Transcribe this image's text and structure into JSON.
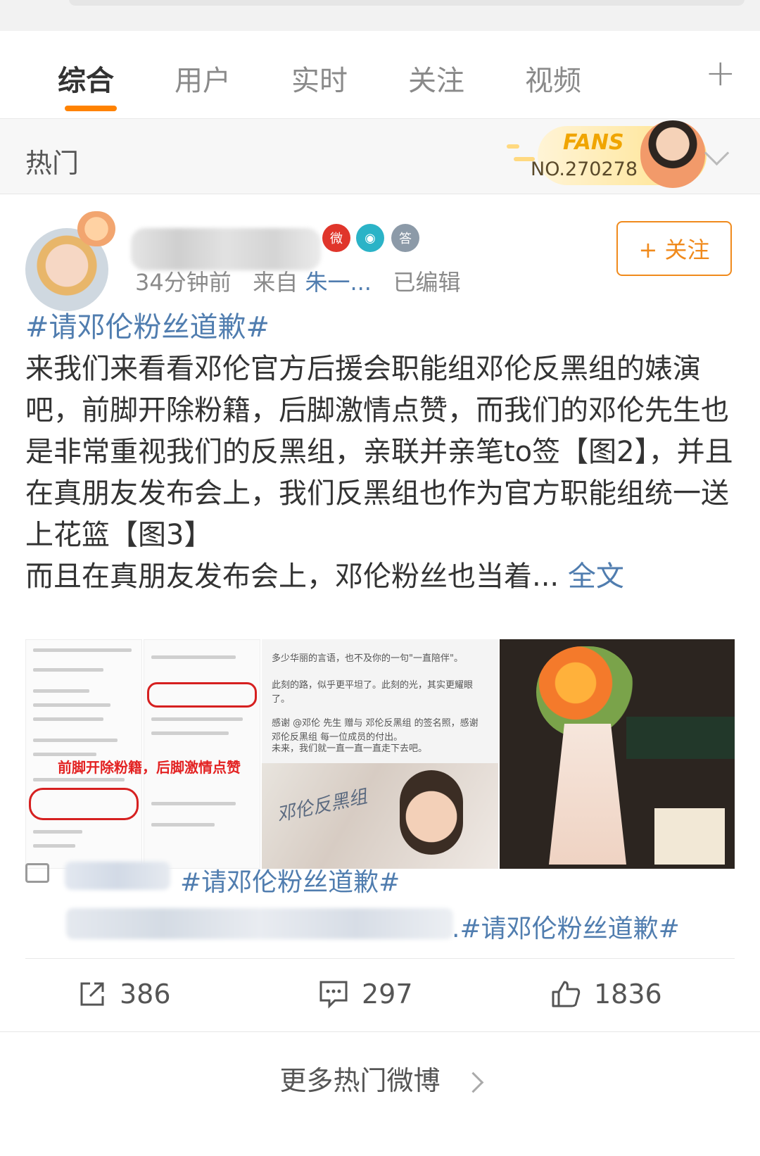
{
  "tabs": {
    "items": [
      {
        "label": "综合",
        "active": true
      },
      {
        "label": "用户"
      },
      {
        "label": "实时"
      },
      {
        "label": "关注"
      },
      {
        "label": "视频"
      }
    ],
    "more_icon": "plus-icon"
  },
  "hot": {
    "label": "热门",
    "fans_badge": {
      "title": "FANS",
      "number": "NO.270278"
    },
    "expand_icon": "chevron-down-icon"
  },
  "post": {
    "meta": {
      "time": "34分钟前",
      "from_prefix": "来自",
      "source": "朱一...",
      "edited": "已编辑"
    },
    "badges": [
      "weibo-icon",
      "camera-icon",
      "answer-icon"
    ],
    "follow_label": "+ 关注",
    "hashtag": "#请邓伦粉丝道歉#",
    "body": "来我们来看看邓伦官方后援会职能组邓伦反黑组的婊演吧，前脚开除粉籍，后脚激情点赞，而我们的邓伦先生也是非常重视我们的反黑组，亲联并亲笔to签【图2】，并且在真朋友发布会上，我们反黑组也作为官方职能组统一送上花篮【图3】",
    "body_tail": "而且在真朋友发布会上，邓伦粉丝也当着...",
    "fulltext": "全文",
    "images": {
      "img2_red_text": "前脚开除粉籍，后脚激情点赞",
      "img3_lines": [
        "多少华丽的言语，也不及你的一句\"一直陪伴\"。",
        "此刻的路，似乎更平坦了。此刻的光，其实更耀眼了。",
        "感谢 @邓伦 先生 赠与 邓伦反黑组 的签名照，感谢 邓伦反黑组 每一位成员的付出。",
        "未来，我们就一直一直一直走下去吧。"
      ],
      "img3_sign": "邓伦反黑组"
    },
    "comments": [
      {
        "tag": "#请邓伦粉丝道歉#"
      },
      {
        "tag": ".#请邓伦粉丝道歉#"
      }
    ],
    "actions": {
      "repost": "386",
      "comment": "297",
      "like": "1836"
    }
  },
  "footer": {
    "more": "更多热门微博"
  },
  "colors": {
    "accent": "#ff8200",
    "link": "#507daf"
  }
}
